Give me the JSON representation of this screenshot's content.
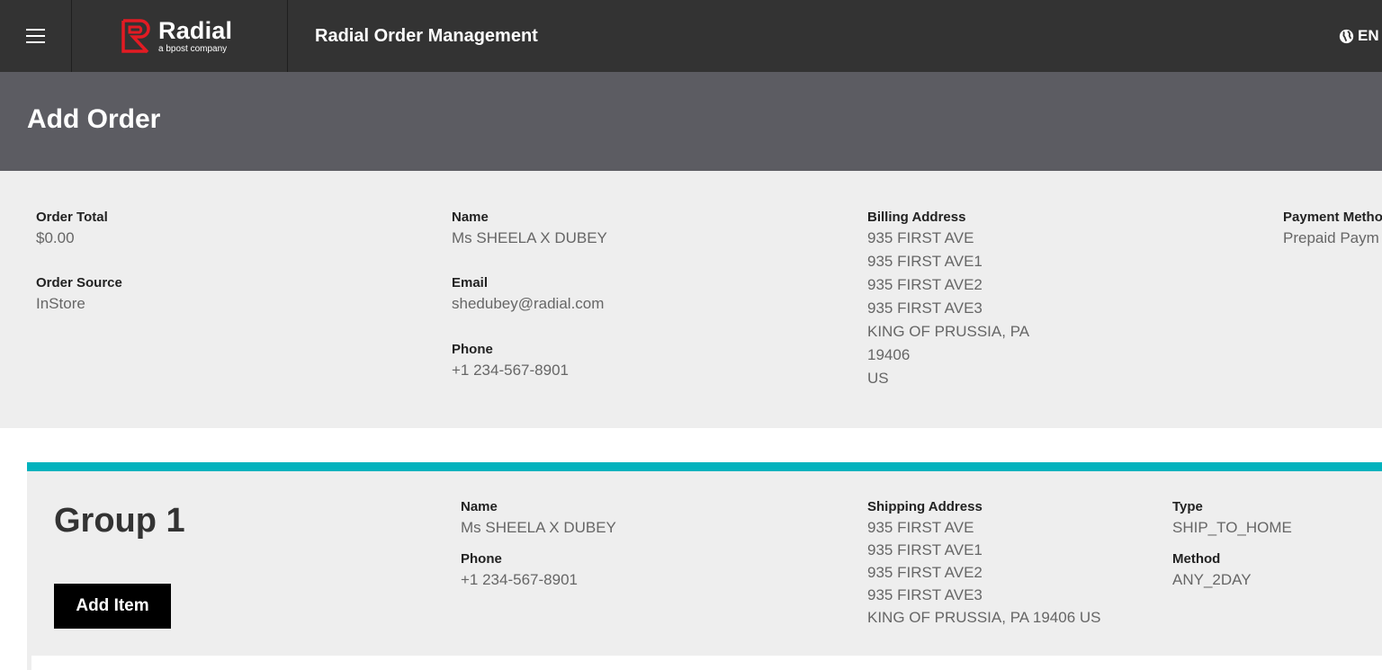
{
  "header": {
    "logo_word": "Radial",
    "logo_sub": "a bpost company",
    "app_title": "Radial Order Management",
    "language": "EN",
    "menu_icon": "hamburger-icon",
    "language_icon": "globe-icon",
    "brand_color": "#e31b23"
  },
  "page": {
    "title": "Add Order"
  },
  "summary": {
    "order_total_label": "Order Total",
    "order_total_value": "$0.00",
    "order_source_label": "Order Source",
    "order_source_value": "InStore",
    "name_label": "Name",
    "name_value": "Ms SHEELA X DUBEY",
    "email_label": "Email",
    "email_value": "shedubey@radial.com",
    "phone_label": "Phone",
    "phone_value": "+1 234-567-8901",
    "billing_label": "Billing Address",
    "billing_lines": [
      "935 FIRST AVE",
      "935 FIRST AVE1",
      "935 FIRST AVE2",
      "935 FIRST AVE3",
      "KING OF PRUSSIA, PA",
      "19406",
      "US"
    ],
    "payment_label": "Payment Metho",
    "payment_value": "Prepaid Paym"
  },
  "group": {
    "title": "Group 1",
    "add_item_label": "Add Item",
    "accent_color": "#00b2bd",
    "name_label": "Name",
    "name_value": "Ms SHEELA X DUBEY",
    "phone_label": "Phone",
    "phone_value": "+1 234-567-8901",
    "shipping_label": "Shipping Address",
    "shipping_lines": [
      "935 FIRST AVE",
      "935 FIRST AVE1",
      "935 FIRST AVE2",
      "935 FIRST AVE3",
      "KING OF PRUSSIA, PA 19406 US"
    ],
    "type_label": "Type",
    "type_value": "SHIP_TO_HOME",
    "method_label": "Method",
    "method_value": "ANY_2DAY"
  }
}
